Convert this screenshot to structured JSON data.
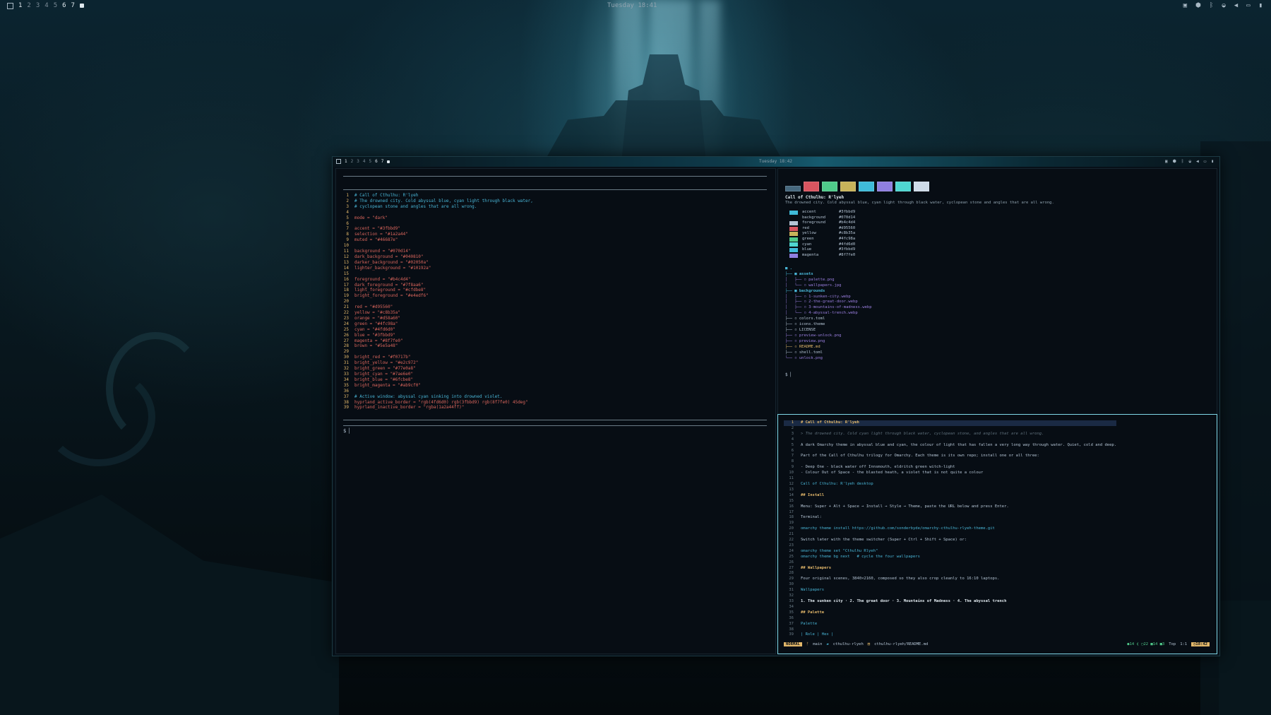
{
  "topbar": {
    "workspaces": [
      "1",
      "2",
      "3",
      "4",
      "5",
      "6",
      "7"
    ],
    "clock": "Tuesday 18:41"
  },
  "inner_topbar": {
    "workspaces": [
      "1",
      "2",
      "3",
      "4",
      "5",
      "6",
      "7"
    ],
    "clock": "Tuesday 18:42"
  },
  "left_editor": {
    "lines": [
      {
        "n": "1",
        "t": "# Call of Cthulhu: R'lyeh",
        "c": "cm"
      },
      {
        "n": "2",
        "t": "# The drowned city. Cold abyssal blue, cyan light through black water,",
        "c": "cm"
      },
      {
        "n": "3",
        "t": "# cyclopean stone and angles that are all wrong.",
        "c": "cm"
      },
      {
        "n": "4",
        "t": "",
        "c": ""
      },
      {
        "n": "5",
        "t": "mode = \"dark\"",
        "c": "kw"
      },
      {
        "n": "6",
        "t": "",
        "c": ""
      },
      {
        "n": "7",
        "t": "accent = \"#3fbbd9\"",
        "c": "kw"
      },
      {
        "n": "8",
        "t": "selection = \"#1a2a44\"",
        "c": "kw"
      },
      {
        "n": "9",
        "t": "muted = \"#46687e\"",
        "c": "kw"
      },
      {
        "n": "10",
        "t": "",
        "c": ""
      },
      {
        "n": "11",
        "t": "background = \"#070d14\"",
        "c": "kw"
      },
      {
        "n": "12",
        "t": "dark_background = \"#040810\"",
        "c": "kw"
      },
      {
        "n": "13",
        "t": "darker_background = \"#02050a\"",
        "c": "kw"
      },
      {
        "n": "14",
        "t": "lighter_background = \"#10192a\"",
        "c": "kw"
      },
      {
        "n": "15",
        "t": "",
        "c": ""
      },
      {
        "n": "16",
        "t": "foreground = \"#b4c4d4\"",
        "c": "kw"
      },
      {
        "n": "17",
        "t": "dark_foreground = \"#7f8aa6\"",
        "c": "kw"
      },
      {
        "n": "18",
        "t": "light_foreground = \"#cfdbe8\"",
        "c": "kw"
      },
      {
        "n": "19",
        "t": "bright_foreground = \"#e4edf6\"",
        "c": "kw"
      },
      {
        "n": "20",
        "t": "",
        "c": ""
      },
      {
        "n": "21",
        "t": "red = \"#d95560\"",
        "c": "kw"
      },
      {
        "n": "22",
        "t": "yellow = \"#c8b35a\"",
        "c": "kw"
      },
      {
        "n": "23",
        "t": "orange = \"#d58a60\"",
        "c": "kw"
      },
      {
        "n": "24",
        "t": "green = \"#4fc98a\"",
        "c": "kw"
      },
      {
        "n": "25",
        "t": "cyan = \"#4fd6d0\"",
        "c": "kw"
      },
      {
        "n": "26",
        "t": "blue = \"#3fbbd9\"",
        "c": "kw"
      },
      {
        "n": "27",
        "t": "magenta = \"#8f7fe0\"",
        "c": "kw"
      },
      {
        "n": "28",
        "t": "brown = \"#5e5a48\"",
        "c": "kw"
      },
      {
        "n": "29",
        "t": "",
        "c": ""
      },
      {
        "n": "30",
        "t": "bright_red = \"#f0717b\"",
        "c": "kw"
      },
      {
        "n": "31",
        "t": "bright_yellow = \"#e2c972\"",
        "c": "kw"
      },
      {
        "n": "32",
        "t": "bright_green = \"#77e0a8\"",
        "c": "kw"
      },
      {
        "n": "33",
        "t": "bright_cyan = \"#7ae6e0\"",
        "c": "kw"
      },
      {
        "n": "34",
        "t": "bright_blue = \"#6fcbe8\"",
        "c": "kw"
      },
      {
        "n": "35",
        "t": "bright_magenta = \"#ab9cf0\"",
        "c": "kw"
      },
      {
        "n": "36",
        "t": "",
        "c": ""
      },
      {
        "n": "37",
        "t": "# Active window: abyssal cyan sinking into drowned violet.",
        "c": "cm"
      },
      {
        "n": "38",
        "t": "hyprland_active_border = \"rgb(4fd6d0) rgb(3fbbd9) rgb(8f7fe0) 45deg\"",
        "c": "kw"
      },
      {
        "n": "39",
        "t": "hyprland_inactive_border = \"rgba(1a2a44ff)\"",
        "c": "kw"
      }
    ],
    "prompt": "$ ▏"
  },
  "palette_pane": {
    "swatch_colors": [
      "#46687e",
      "#d95560",
      "#4fc98a",
      "#c8b35a",
      "#3fbbd9",
      "#8f7fe0",
      "#4fd6d0",
      "#cfdbe8"
    ],
    "title": "Call of Cthulhu: R'lyeh",
    "subtitle": "The drowned city. Cold abyssal blue, cyan light through black water, cyclopean stone and angles that are all wrong.",
    "roles": [
      {
        "role": "accent",
        "hex": "#3fbbd9"
      },
      {
        "role": "background",
        "hex": "#070d14"
      },
      {
        "role": "foreground",
        "hex": "#b4c4d4"
      },
      {
        "role": "red",
        "hex": "#d95560"
      },
      {
        "role": "yellow",
        "hex": "#c8b35a"
      },
      {
        "role": "green",
        "hex": "#4fc98a"
      },
      {
        "role": "cyan",
        "hex": "#4fd6d0"
      },
      {
        "role": "blue",
        "hex": "#3fbbd9"
      },
      {
        "role": "magenta",
        "hex": "#8f7fe0"
      }
    ],
    "tree": [
      {
        "t": "■ .",
        "c": "dir"
      },
      {
        "t": "├── ■ assets",
        "c": "dir"
      },
      {
        "t": "│   ├── ▫ palette.png",
        "c": "img"
      },
      {
        "t": "│   └── ▫ wallpapers.jpg",
        "c": "img"
      },
      {
        "t": "├── ■ backgrounds",
        "c": "dir"
      },
      {
        "t": "│   ├── ▫ 1-sunken-city.webp",
        "c": "img"
      },
      {
        "t": "│   ├── ▫ 2-the-great-door.webp",
        "c": "img"
      },
      {
        "t": "│   ├── ▫ 3-mountains-of-madness.webp",
        "c": "img"
      },
      {
        "t": "│   └── ▫ 4-abyssal-trench.webp",
        "c": "img"
      },
      {
        "t": "├── ▫ colors.toml",
        "c": ""
      },
      {
        "t": "├── ▫ icons.theme",
        "c": ""
      },
      {
        "t": "├── ▫ LICENSE",
        "c": ""
      },
      {
        "t": "├── ▫ preview-unlock.png",
        "c": "img"
      },
      {
        "t": "├── ▫ preview.png",
        "c": "img"
      },
      {
        "t": "├── ▫ README.md",
        "c": "md"
      },
      {
        "t": "├── ▫ shell.toml",
        "c": ""
      },
      {
        "t": "└── ▫ unlock.png",
        "c": "img"
      }
    ],
    "prompt": "$ ▏"
  },
  "readme_pane": {
    "lines": [
      {
        "n": "1",
        "t": "# Call of Cthulhu: R'lyeh",
        "c": "h"
      },
      {
        "n": "2",
        "t": "",
        "c": ""
      },
      {
        "n": "3",
        "t": "> The drowned city. Cold cyan light through black water, cyclopean stone, and angles that are all wrong.",
        "c": "dim"
      },
      {
        "n": "4",
        "t": "",
        "c": ""
      },
      {
        "n": "5",
        "t": "A dark Omarchy theme in abyssal blue and cyan, the colour of light that has fallen a very long way through water. Quiet, cold and deep.",
        "c": ""
      },
      {
        "n": "6",
        "t": "",
        "c": ""
      },
      {
        "n": "7",
        "t": "Part of the Call of Cthulhu trilogy for Omarchy. Each theme is its own repo; install one or all three:",
        "c": ""
      },
      {
        "n": "8",
        "t": "",
        "c": ""
      },
      {
        "n": "9",
        "t": "- Deep One - black water off Innsmouth, eldritch green witch-light",
        "c": ""
      },
      {
        "n": "10",
        "t": "- Colour Out of Space - the blasted heath, a violet that is not quite a colour",
        "c": ""
      },
      {
        "n": "11",
        "t": "",
        "c": ""
      },
      {
        "n": "12",
        "t": "Call of Cthulhu: R'lyeh desktop",
        "c": "lk"
      },
      {
        "n": "13",
        "t": "",
        "c": ""
      },
      {
        "n": "14",
        "t": "## Install",
        "c": "h"
      },
      {
        "n": "15",
        "t": "",
        "c": ""
      },
      {
        "n": "16",
        "t": "Menu: Super + Alt + Space → Install → Style → Theme, paste the URL below and press Enter.",
        "c": ""
      },
      {
        "n": "17",
        "t": "",
        "c": ""
      },
      {
        "n": "18",
        "t": "Terminal:",
        "c": ""
      },
      {
        "n": "19",
        "t": "",
        "c": ""
      },
      {
        "n": "20",
        "t": "omarchy theme install https://github.com/sonderbyde/omarchy-cthulhu-rlyeh-theme.git",
        "c": "lk"
      },
      {
        "n": "21",
        "t": "",
        "c": ""
      },
      {
        "n": "22",
        "t": "Switch later with the theme switcher (Super + Ctrl + Shift + Space) or:",
        "c": ""
      },
      {
        "n": "23",
        "t": "",
        "c": ""
      },
      {
        "n": "24",
        "t": "omarchy theme set \"Cthulhu Rlyeh\"",
        "c": "lk"
      },
      {
        "n": "25",
        "t": "omarchy theme bg next   # cycle the four wallpapers",
        "c": "lk"
      },
      {
        "n": "26",
        "t": "",
        "c": ""
      },
      {
        "n": "27",
        "t": "## Wallpapers",
        "c": "h"
      },
      {
        "n": "28",
        "t": "",
        "c": ""
      },
      {
        "n": "29",
        "t": "Four original scenes, 3840×2160, composed so they also crop cleanly to 16:10 laptops.",
        "c": ""
      },
      {
        "n": "30",
        "t": "",
        "c": ""
      },
      {
        "n": "31",
        "t": "Wallpapers",
        "c": "lk"
      },
      {
        "n": "32",
        "t": "",
        "c": ""
      },
      {
        "n": "33",
        "t": "1. The sunken city · 2. The great door · 3. Mountains of Madness · 4. The abyssal trench",
        "c": "bold"
      },
      {
        "n": "34",
        "t": "",
        "c": ""
      },
      {
        "n": "35",
        "t": "## Palette",
        "c": "h"
      },
      {
        "n": "36",
        "t": "",
        "c": ""
      },
      {
        "n": "37",
        "t": "Palette",
        "c": "lk"
      },
      {
        "n": "38",
        "t": "",
        "c": ""
      },
      {
        "n": "39",
        "t": "| Role | Hex |",
        "c": "lk"
      }
    ],
    "status": {
      "mode": "NORMAL",
      "branch": "main",
      "folder": "cthulhu-rlyeh",
      "file": "cthulhu-rlyeh/README.md",
      "diag": "●14 ❮ ▢22 ■14 ■3",
      "pos": "Top",
      "loc": "1:1",
      "time": "◷18:42"
    }
  }
}
